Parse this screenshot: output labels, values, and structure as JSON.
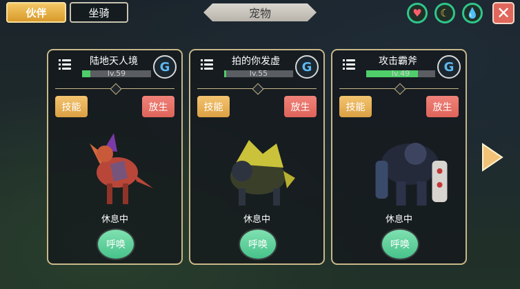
{
  "top": {
    "tab_partner": "伙伴",
    "tab_mount": "坐骑",
    "title": "宠物",
    "actions": [
      "heart-icon",
      "banana-icon",
      "water-drop-icon"
    ],
    "close_icon": "✕"
  },
  "pets": [
    {
      "name": "陆地天人境",
      "level": "lv.59",
      "level_progress": 0.12,
      "skill": "技能",
      "release": "放生",
      "status": "休息中",
      "summon": "呼唤"
    },
    {
      "name": "拍的你发虚",
      "level": "lv.55",
      "level_progress": 0.03,
      "skill": "技能",
      "release": "放生",
      "status": "休息中",
      "summon": "呼唤"
    },
    {
      "name": "攻击霸斧",
      "level": "lv.49",
      "level_progress": 0.75,
      "skill": "技能",
      "release": "放生",
      "status": "休息中",
      "summon": "呼唤"
    }
  ],
  "colors": {
    "accent": "#f3c866",
    "release": "#e0675c",
    "summon": "#47c28a",
    "level": "#4fce6a"
  }
}
